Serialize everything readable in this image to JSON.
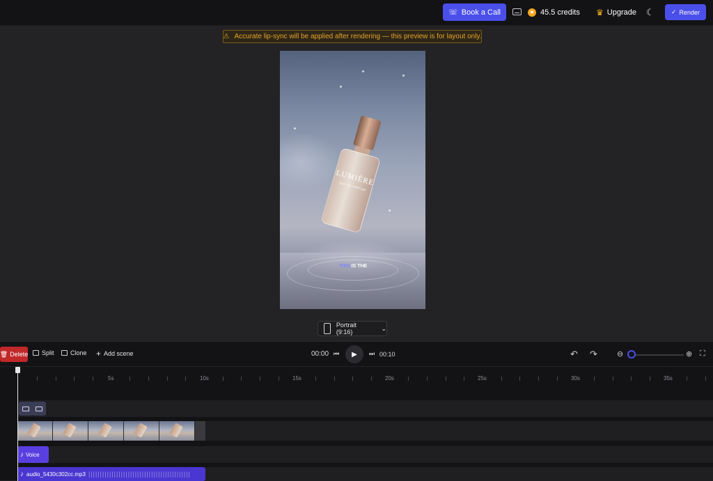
{
  "topbar": {
    "book_call_label": "Book a Call",
    "credits_label": "45.5 credits",
    "upgrade_label": "Upgrade",
    "render_label": "Render"
  },
  "warning": {
    "text": "Accurate lip-sync will be applied after rendering — this preview is for layout only."
  },
  "preview": {
    "brand": "LUMIÈRE",
    "brand_sub": "EAU DE PARFUM",
    "caption_highlight": "THIS",
    "caption_rest": " IS THE"
  },
  "aspect": {
    "label": "Portrait (9:16)"
  },
  "toolbar": {
    "delete_label": "Delete",
    "split_label": "Split",
    "clone_label": "Clone",
    "add_scene_label": "Add scene",
    "current_time": "00:00",
    "total_time": "00:10"
  },
  "ruler": {
    "labels": [
      "5s",
      "10s",
      "15s",
      "20s",
      "25s",
      "30s",
      "35s"
    ]
  },
  "tracks": {
    "voice_label": "Voice",
    "audio_label": "audio_5430c302cc.mp3"
  },
  "colors": {
    "accent": "#4a4fea",
    "danger": "#c0282a",
    "warning": "#e8a22b",
    "voice_track": "#5a3fe0"
  }
}
